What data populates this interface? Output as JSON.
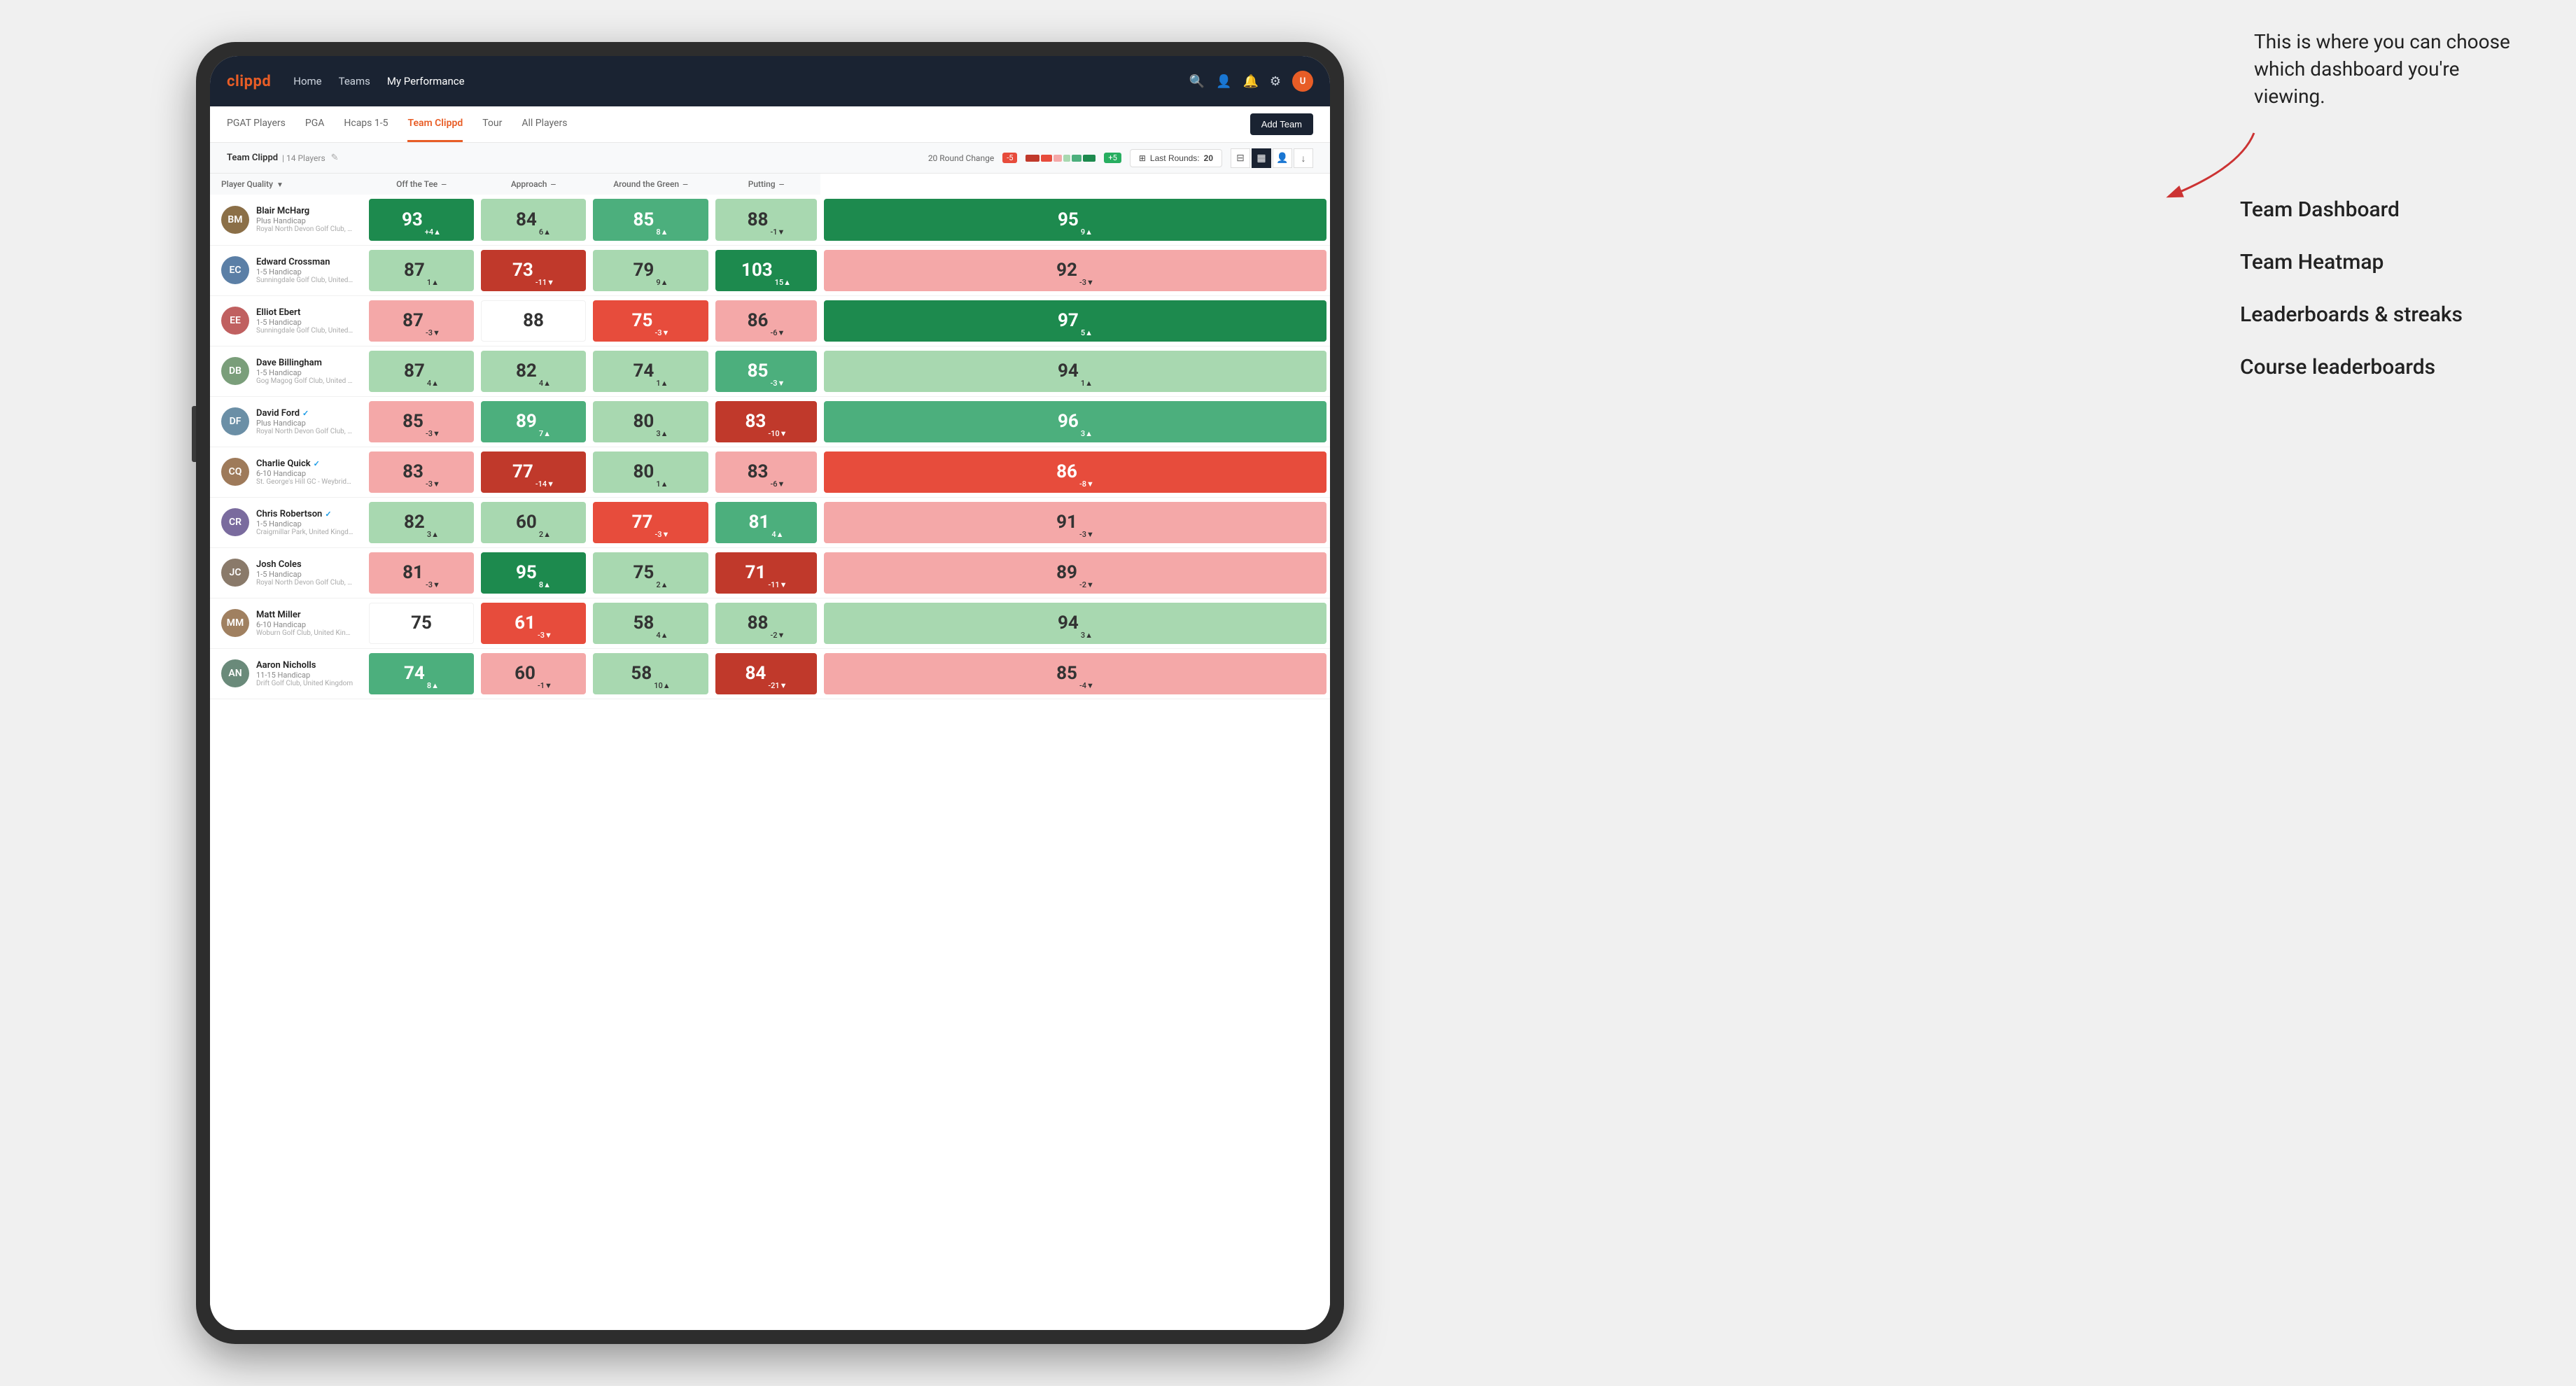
{
  "annotation": {
    "intro_text": "This is where you can choose which dashboard you're viewing.",
    "items": [
      "Team Dashboard",
      "Team Heatmap",
      "Leaderboards & streaks",
      "Course leaderboards"
    ]
  },
  "nav": {
    "logo": "clippd",
    "items": [
      "Home",
      "Teams",
      "My Performance"
    ],
    "active_item": "My Performance"
  },
  "sub_tabs": {
    "items": [
      "PGAT Players",
      "PGA",
      "Hcaps 1-5",
      "Team Clippd",
      "Tour",
      "All Players"
    ],
    "active": "Team Clippd",
    "add_button": "Add Team"
  },
  "team_info": {
    "name": "Team Clippd",
    "separator": "|",
    "count": "14 Players",
    "round_change_label": "20 Round Change",
    "change_neg": "-5",
    "change_pos": "+5",
    "last_rounds_label": "Last Rounds:",
    "last_rounds_value": "20"
  },
  "table": {
    "columns": [
      {
        "key": "player",
        "label": "Player Quality",
        "sortable": true
      },
      {
        "key": "off_tee",
        "label": "Off the Tee",
        "sortable": true
      },
      {
        "key": "approach",
        "label": "Approach",
        "sortable": true
      },
      {
        "key": "around_green",
        "label": "Around the Green",
        "sortable": true
      },
      {
        "key": "putting",
        "label": "Putting",
        "sortable": true
      }
    ],
    "players": [
      {
        "name": "Blair McHarg",
        "handicap": "Plus Handicap",
        "club": "Royal North Devon Golf Club, United Kingdom",
        "avatar_color": "#8B6F47",
        "initials": "BM",
        "scores": [
          {
            "value": 93,
            "change": "+4",
            "direction": "up",
            "color": "dark-green"
          },
          {
            "value": 84,
            "change": "6",
            "direction": "up",
            "color": "light-green"
          },
          {
            "value": 85,
            "change": "8",
            "direction": "up",
            "color": "med-green"
          },
          {
            "value": 88,
            "change": "-1",
            "direction": "down",
            "color": "light-green"
          },
          {
            "value": 95,
            "change": "9",
            "direction": "up",
            "color": "dark-green"
          }
        ]
      },
      {
        "name": "Edward Crossman",
        "handicap": "1-5 Handicap",
        "club": "Sunningdale Golf Club, United Kingdom",
        "avatar_color": "#5B7FA6",
        "initials": "EC",
        "scores": [
          {
            "value": 87,
            "change": "1",
            "direction": "up",
            "color": "light-green"
          },
          {
            "value": 73,
            "change": "-11",
            "direction": "down",
            "color": "dark-red"
          },
          {
            "value": 79,
            "change": "9",
            "direction": "up",
            "color": "light-green"
          },
          {
            "value": 103,
            "change": "15",
            "direction": "up",
            "color": "dark-green"
          },
          {
            "value": 92,
            "change": "-3",
            "direction": "down",
            "color": "light-red"
          }
        ]
      },
      {
        "name": "Elliot Ebert",
        "handicap": "1-5 Handicap",
        "club": "Sunningdale Golf Club, United Kingdom",
        "avatar_color": "#C06060",
        "initials": "EE",
        "scores": [
          {
            "value": 87,
            "change": "-3",
            "direction": "down",
            "color": "light-red"
          },
          {
            "value": 88,
            "change": "",
            "direction": "",
            "color": "white"
          },
          {
            "value": 75,
            "change": "-3",
            "direction": "down",
            "color": "med-red"
          },
          {
            "value": 86,
            "change": "-6",
            "direction": "down",
            "color": "light-red"
          },
          {
            "value": 97,
            "change": "5",
            "direction": "up",
            "color": "dark-green"
          }
        ]
      },
      {
        "name": "Dave Billingham",
        "handicap": "1-5 Handicap",
        "club": "Gog Magog Golf Club, United Kingdom",
        "avatar_color": "#7A9E7A",
        "initials": "DB",
        "scores": [
          {
            "value": 87,
            "change": "4",
            "direction": "up",
            "color": "light-green"
          },
          {
            "value": 82,
            "change": "4",
            "direction": "up",
            "color": "light-green"
          },
          {
            "value": 74,
            "change": "1",
            "direction": "up",
            "color": "light-green"
          },
          {
            "value": 85,
            "change": "-3",
            "direction": "down",
            "color": "med-green"
          },
          {
            "value": 94,
            "change": "1",
            "direction": "up",
            "color": "light-green"
          }
        ]
      },
      {
        "name": "David Ford",
        "handicap": "Plus Handicap",
        "club": "Royal North Devon Golf Club, United Kingdom",
        "avatar_color": "#6B8FA6",
        "initials": "DF",
        "verified": true,
        "scores": [
          {
            "value": 85,
            "change": "-3",
            "direction": "down",
            "color": "light-red"
          },
          {
            "value": 89,
            "change": "7",
            "direction": "up",
            "color": "med-green"
          },
          {
            "value": 80,
            "change": "3",
            "direction": "up",
            "color": "light-green"
          },
          {
            "value": 83,
            "change": "-10",
            "direction": "down",
            "color": "dark-red"
          },
          {
            "value": 96,
            "change": "3",
            "direction": "up",
            "color": "med-green"
          }
        ]
      },
      {
        "name": "Charlie Quick",
        "handicap": "6-10 Handicap",
        "club": "St. George's Hill GC - Weybridge - Surrey, Uni...",
        "avatar_color": "#9E7A5A",
        "initials": "CQ",
        "verified": true,
        "scores": [
          {
            "value": 83,
            "change": "-3",
            "direction": "down",
            "color": "light-red"
          },
          {
            "value": 77,
            "change": "-14",
            "direction": "down",
            "color": "dark-red"
          },
          {
            "value": 80,
            "change": "1",
            "direction": "up",
            "color": "light-green"
          },
          {
            "value": 83,
            "change": "-6",
            "direction": "down",
            "color": "light-red"
          },
          {
            "value": 86,
            "change": "-8",
            "direction": "down",
            "color": "med-red"
          }
        ]
      },
      {
        "name": "Chris Robertson",
        "handicap": "1-5 Handicap",
        "club": "Craigmillar Park, United Kingdom",
        "avatar_color": "#7A6B9E",
        "initials": "CR",
        "verified": true,
        "scores": [
          {
            "value": 82,
            "change": "3",
            "direction": "up",
            "color": "light-green"
          },
          {
            "value": 60,
            "change": "2",
            "direction": "up",
            "color": "light-green"
          },
          {
            "value": 77,
            "change": "-3",
            "direction": "down",
            "color": "med-red"
          },
          {
            "value": 81,
            "change": "4",
            "direction": "up",
            "color": "med-green"
          },
          {
            "value": 91,
            "change": "-3",
            "direction": "down",
            "color": "light-red"
          }
        ]
      },
      {
        "name": "Josh Coles",
        "handicap": "1-5 Handicap",
        "club": "Royal North Devon Golf Club, United Kingdom",
        "avatar_color": "#8A7A6A",
        "initials": "JC",
        "scores": [
          {
            "value": 81,
            "change": "-3",
            "direction": "down",
            "color": "light-red"
          },
          {
            "value": 95,
            "change": "8",
            "direction": "up",
            "color": "dark-green"
          },
          {
            "value": 75,
            "change": "2",
            "direction": "up",
            "color": "light-green"
          },
          {
            "value": 71,
            "change": "-11",
            "direction": "down",
            "color": "dark-red"
          },
          {
            "value": 89,
            "change": "-2",
            "direction": "down",
            "color": "light-red"
          }
        ]
      },
      {
        "name": "Matt Miller",
        "handicap": "6-10 Handicap",
        "club": "Woburn Golf Club, United Kingdom",
        "avatar_color": "#A08060",
        "initials": "MM",
        "scores": [
          {
            "value": 75,
            "change": "",
            "direction": "",
            "color": "white"
          },
          {
            "value": 61,
            "change": "-3",
            "direction": "down",
            "color": "med-red"
          },
          {
            "value": 58,
            "change": "4",
            "direction": "up",
            "color": "light-green"
          },
          {
            "value": 88,
            "change": "-2",
            "direction": "down",
            "color": "light-green"
          },
          {
            "value": 94,
            "change": "3",
            "direction": "up",
            "color": "light-green"
          }
        ]
      },
      {
        "name": "Aaron Nicholls",
        "handicap": "11-15 Handicap",
        "club": "Drift Golf Club, United Kingdom",
        "avatar_color": "#6A8A7A",
        "initials": "AN",
        "scores": [
          {
            "value": 74,
            "change": "8",
            "direction": "up",
            "color": "med-green"
          },
          {
            "value": 60,
            "change": "-1",
            "direction": "down",
            "color": "light-red"
          },
          {
            "value": 58,
            "change": "10",
            "direction": "up",
            "color": "light-green"
          },
          {
            "value": 84,
            "change": "-21",
            "direction": "down",
            "color": "dark-red"
          },
          {
            "value": 85,
            "change": "-4",
            "direction": "down",
            "color": "light-red"
          }
        ]
      }
    ]
  }
}
